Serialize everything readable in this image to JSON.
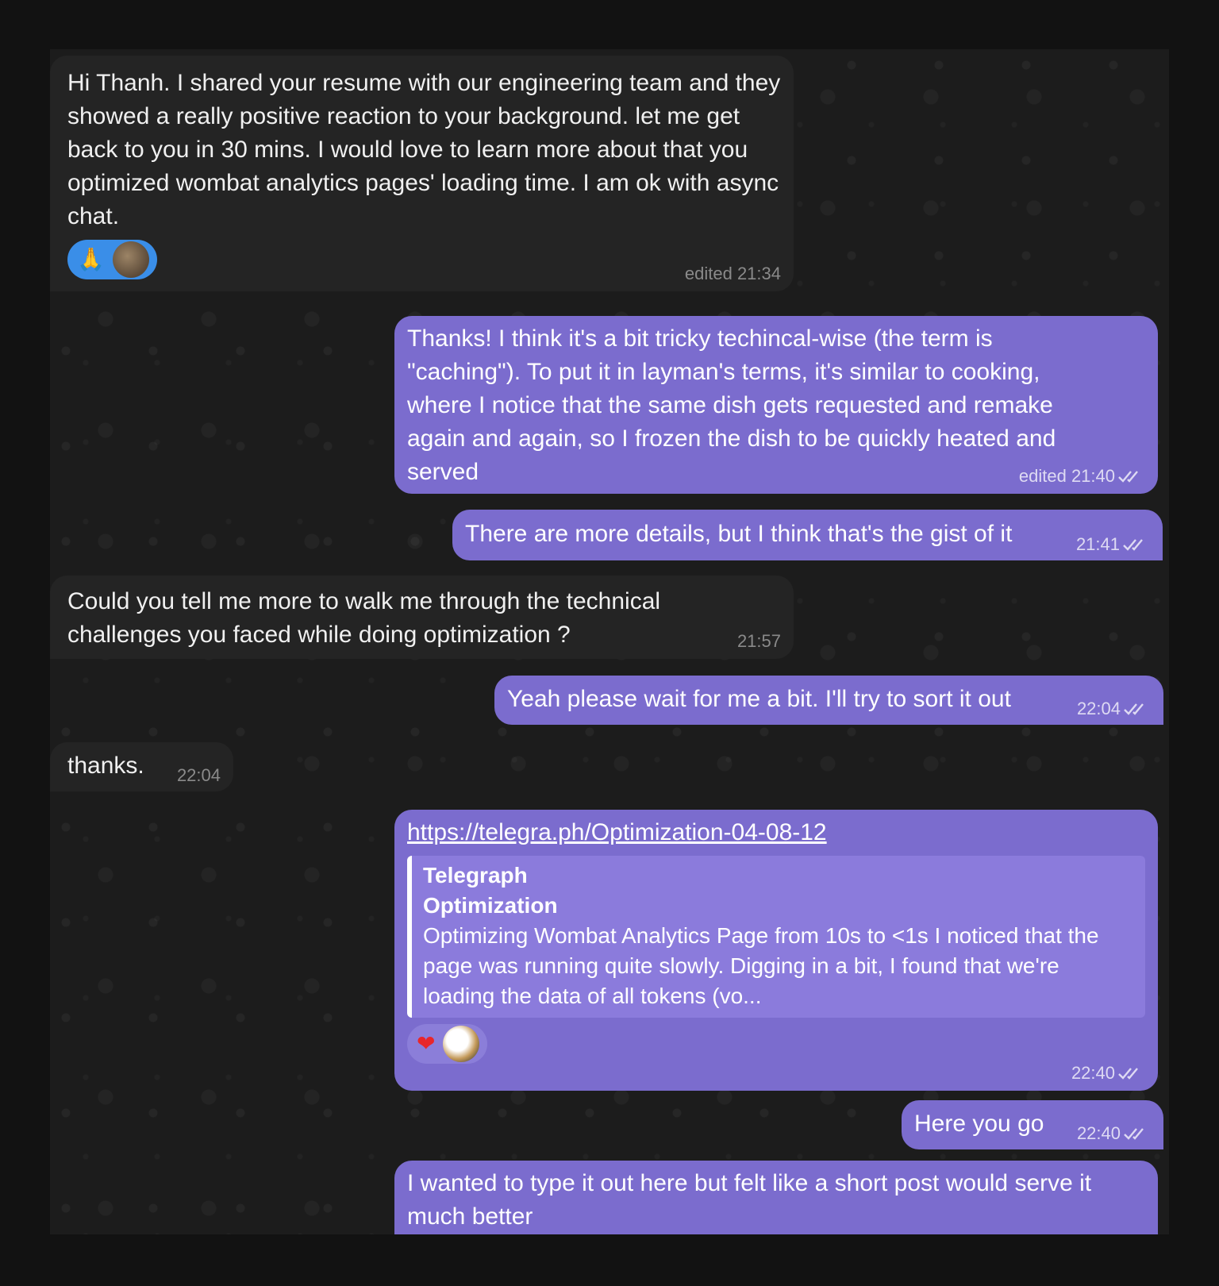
{
  "messages": [
    {
      "direction": "incoming",
      "text": "Hi Thanh. I shared your resume with our engineering team and they showed a really positive reaction to your background. let me get back to you in 30 mins. I would love to learn more about that you optimized wombat analytics pages' loading time.  I am ok with async chat.",
      "reactions": [
        {
          "emoji": "🙏",
          "name": "folded-hands"
        },
        {
          "avatar": "cat-avatar"
        }
      ],
      "meta": "edited 21:34"
    },
    {
      "direction": "outgoing",
      "text": "Thanks! I think it's a bit tricky techincal-wise (the term is \"caching\"). To put it in layman's terms, it's similar to cooking, where I notice that the same dish gets requested and remake again and again, so I frozen the dish to be quickly heated and served",
      "meta": "edited 21:40",
      "read": true
    },
    {
      "direction": "outgoing",
      "text": "There are more details, but I think that's the gist of it",
      "meta": "21:41",
      "read": true
    },
    {
      "direction": "incoming",
      "text": "Could you tell me more to walk me through the technical challenges you faced while doing optimization ?",
      "meta": "21:57"
    },
    {
      "direction": "outgoing",
      "text": "Yeah please wait for me a bit. I'll try to sort it out",
      "meta": "22:04",
      "read": true
    },
    {
      "direction": "incoming",
      "text": "thanks.",
      "meta": "22:04"
    },
    {
      "direction": "outgoing",
      "link": "https://telegra.ph/Optimization-04-08-12",
      "preview": {
        "site": "Telegraph",
        "title": "Optimization",
        "description": "Optimizing Wombat Analytics Page from 10s to <1s I noticed that the page was running quite slowly. Digging in a bit, I found that we're loading the data of all tokens (vo..."
      },
      "reactions": [
        {
          "emoji": "❤",
          "name": "heart"
        },
        {
          "avatar": "dog-avatar"
        }
      ],
      "meta": "22:40",
      "read": true
    },
    {
      "direction": "outgoing",
      "text": "Here you go",
      "meta": "22:40",
      "read": true
    },
    {
      "direction": "outgoing",
      "text": "I wanted to type it out here but felt like a short post would serve it much better"
    }
  ],
  "colors": {
    "page_background": "#121212",
    "incoming_bubble": "#242424",
    "outgoing_bubble": "#7b6cce",
    "link_preview": "#8b7bdc",
    "reaction_pill_incoming": "#3a8ee8",
    "heart": "#e8262a"
  }
}
